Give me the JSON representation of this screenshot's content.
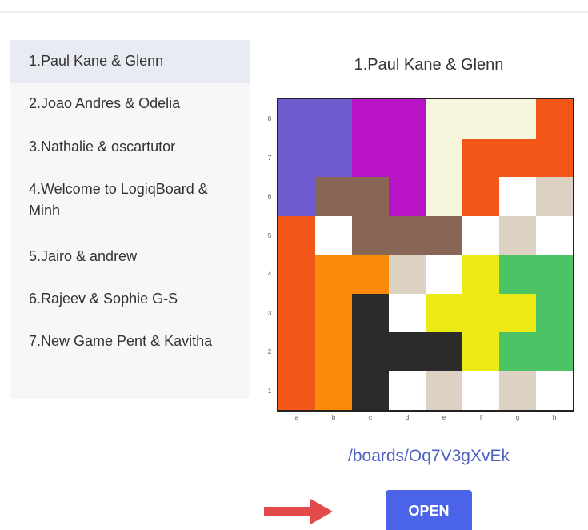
{
  "games": [
    {
      "label": "1.Paul Kane & Glenn",
      "active": true
    },
    {
      "label": "2.Joao Andres & Odelia",
      "active": false
    },
    {
      "label": "3.Nathalie & oscartutor",
      "active": false
    },
    {
      "label": "4.Welcome to LogiqBoard & Minh",
      "active": false
    },
    {
      "label": "5.Jairo & andrew",
      "active": false
    },
    {
      "label": "6.Rajeev & Sophie G-S",
      "active": false
    },
    {
      "label": "7.New Game Pent & Kavitha",
      "active": false
    }
  ],
  "board": {
    "title": "1.Paul Kane & Glenn",
    "link": "/boards/Oq7V3gXvEk",
    "open_label": "OPEN",
    "ranks": [
      "8",
      "7",
      "6",
      "5",
      "4",
      "3",
      "2",
      "1"
    ],
    "files": [
      "a",
      "b",
      "c",
      "d",
      "e",
      "f",
      "g",
      "h"
    ],
    "palette": {
      "P": "#6f5ccf",
      "M": "#b814c6",
      "C": "#f6f6dc",
      "O": "#f25717",
      "B": "#876655",
      "W": "#ffffff",
      "T": "#dcd1c2",
      "R": "#fb8a0b",
      "Y": "#ecea14",
      "G": "#4cc466",
      "K": "#2b2b2b"
    },
    "cells": [
      [
        "P",
        "P",
        "M",
        "M",
        "C",
        "C",
        "C",
        "O"
      ],
      [
        "P",
        "P",
        "M",
        "M",
        "C",
        "O",
        "O",
        "O"
      ],
      [
        "P",
        "B",
        "B",
        "M",
        "C",
        "O",
        "W",
        "T"
      ],
      [
        "O",
        "W",
        "B",
        "B",
        "B",
        "W",
        "T",
        "W"
      ],
      [
        "O",
        "R",
        "R",
        "T",
        "W",
        "Y",
        "G",
        "G"
      ],
      [
        "O",
        "R",
        "K",
        "W",
        "Y",
        "Y",
        "Y",
        "G"
      ],
      [
        "O",
        "R",
        "K",
        "K",
        "K",
        "Y",
        "G",
        "G"
      ],
      [
        "O",
        "R",
        "K",
        "W",
        "T",
        "W",
        "T",
        "W"
      ]
    ]
  },
  "colors": {
    "accent": "#4a63e8",
    "link": "#5161c4",
    "arrow": "#e24a4a",
    "active_item_bg": "#e9ebf3"
  },
  "icons": {
    "pointer_arrow": "arrow-right-icon"
  }
}
